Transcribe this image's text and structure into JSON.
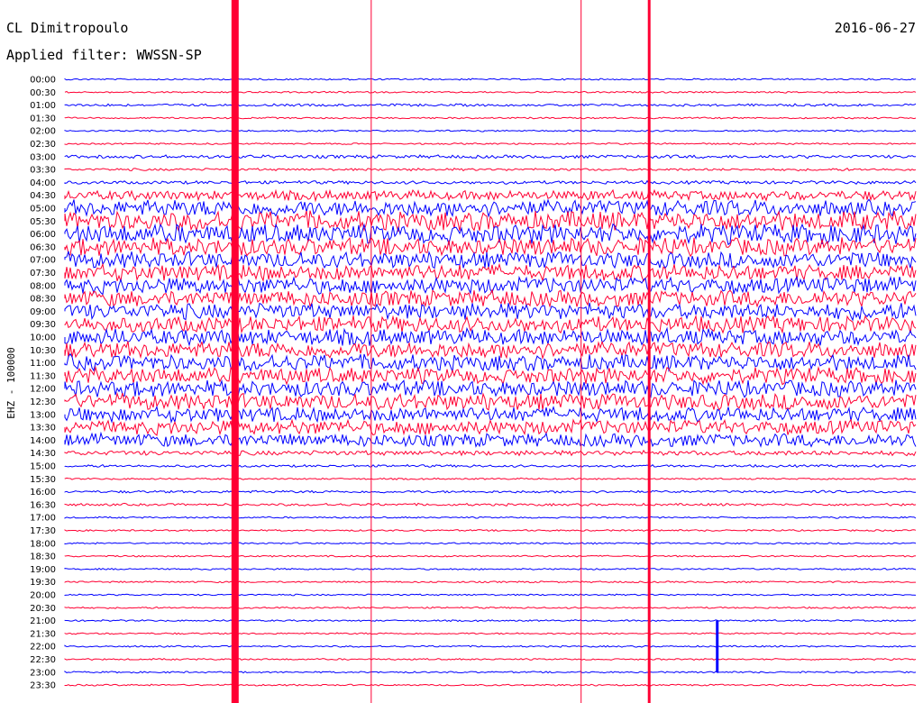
{
  "header": {
    "station": "CL Dimitropoulo",
    "filter": "Applied filter: WWSSN-SP",
    "date": "2016-06-27"
  },
  "chart_data": {
    "type": "line",
    "title": "CL Dimitropoulo",
    "subtitle": "Applied filter: WWSSN-SP",
    "ylabel": "EHZ - 100000",
    "row_times": [
      "00:00",
      "00:30",
      "01:00",
      "01:30",
      "02:00",
      "02:30",
      "03:00",
      "03:30",
      "04:00",
      "04:30",
      "05:00",
      "05:30",
      "06:00",
      "06:30",
      "07:00",
      "07:30",
      "08:00",
      "08:30",
      "09:00",
      "09:30",
      "10:00",
      "10:30",
      "11:00",
      "11:30",
      "12:00",
      "12:30",
      "13:00",
      "13:30",
      "14:00",
      "14:30",
      "15:00",
      "15:30",
      "16:00",
      "16:30",
      "17:00",
      "17:30",
      "18:00",
      "18:30",
      "19:00",
      "19:30",
      "20:00",
      "20:30",
      "21:00",
      "21:30",
      "22:00",
      "22:30",
      "23:00",
      "23:30"
    ],
    "series_colors": [
      "#0000ff",
      "#ff0033"
    ],
    "row_amplitude": [
      1,
      1,
      1.5,
      1,
      1,
      1,
      2,
      1.5,
      2,
      6,
      10,
      12,
      12,
      11,
      10,
      10,
      10,
      10,
      10,
      10,
      10,
      10,
      10,
      10,
      10,
      10,
      9,
      9,
      8,
      3,
      1.5,
      1,
      1.5,
      1.5,
      1,
      1,
      1,
      1,
      1,
      1,
      1,
      1,
      1,
      1,
      1,
      1,
      1,
      1
    ],
    "events": [
      {
        "name": "strong-event",
        "start_minute": 6.0,
        "rows": [
          0,
          47
        ],
        "color": "#ff0033"
      },
      {
        "name": "vertical-line-1",
        "minute": 10.8,
        "color": "#ff0033"
      },
      {
        "name": "vertical-line-2",
        "minute": 20.6,
        "color": "#ff0033"
      },
      {
        "name": "vertical-line-3",
        "minute": 18.2,
        "color": "#ff0033"
      },
      {
        "name": "local-event",
        "minute": 23.0,
        "rows": [
          42,
          46
        ],
        "color": "#0000ff"
      }
    ]
  }
}
